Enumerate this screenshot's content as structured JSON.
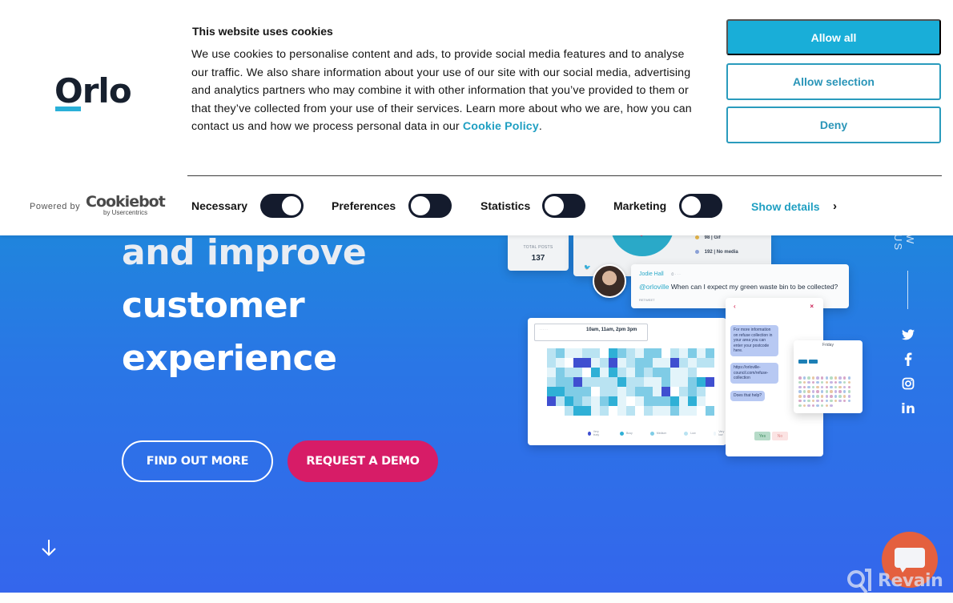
{
  "cookie_banner": {
    "title": "This website uses cookies",
    "body": "We use cookies to personalise content and ads, to provide social media features and to analyse our traffic. We also share information about your use of our site with our social media, advertising and analytics partners who may combine it with other information that you’ve provided to them or that they’ve collected from your use of their services. Learn more about who we are, how you can contact us and how we process personal data in our ",
    "policy_link": "Cookie Policy",
    "body_end": ".",
    "buttons": {
      "allow_all": "Allow all",
      "allow_selection": "Allow selection",
      "deny": "Deny"
    },
    "toggles": [
      {
        "label": "Necessary",
        "state": "on"
      },
      {
        "label": "Preferences",
        "state": "off"
      },
      {
        "label": "Statistics",
        "state": "off"
      },
      {
        "label": "Marketing",
        "state": "off"
      }
    ],
    "show_details": "Show details",
    "powered_by": "Powered by",
    "cookiebot_brand": "Cookiebot",
    "cookiebot_sub": "by Usercentrics"
  },
  "brand": {
    "logo_text": "Orlo",
    "accent_color": "#2ab0d8"
  },
  "hero": {
    "title_lines": [
      "and improve",
      "customer",
      "experience"
    ],
    "find_out_more": "FIND OUT MORE",
    "request_demo": "REQUEST A DEMO",
    "follow_us": "W US",
    "social": [
      "twitter-icon",
      "facebook-icon",
      "instagram-icon",
      "linkedin-icon"
    ]
  },
  "mockup": {
    "total_posts_label": "TOTAL POSTS",
    "total_posts_value": "137",
    "legend": [
      {
        "value": "98",
        "label": "Gif",
        "color": "#e3b44a"
      },
      {
        "value": "192",
        "label": "No media",
        "color": "#8aa0d6"
      }
    ],
    "tweet": {
      "author": "Jodie Hall",
      "handle": "@orloville",
      "message": "When can I expect my green waste bin to be collected?",
      "retweet": "RETWEET"
    },
    "heatmap_header": "10am, 11am, 2pm 3pm",
    "heatmap_legend": [
      "Very busy",
      "Busy",
      "Medium",
      "Low",
      "Very low"
    ],
    "chat": {
      "bubbles": [
        "For more information on refuse collection in your area you can enter your postcode here.",
        "https://orloville-council.com/refuse-collection",
        "Does that help?"
      ],
      "yes": "Yes",
      "no": "No"
    },
    "calendar_day": "Friday"
  },
  "widgets": {
    "revain_label": "Revain"
  },
  "colors": {
    "cta_pink": "#d71c67",
    "cookie_blue": "#19aed8",
    "chat_orange": "#e4603e"
  }
}
